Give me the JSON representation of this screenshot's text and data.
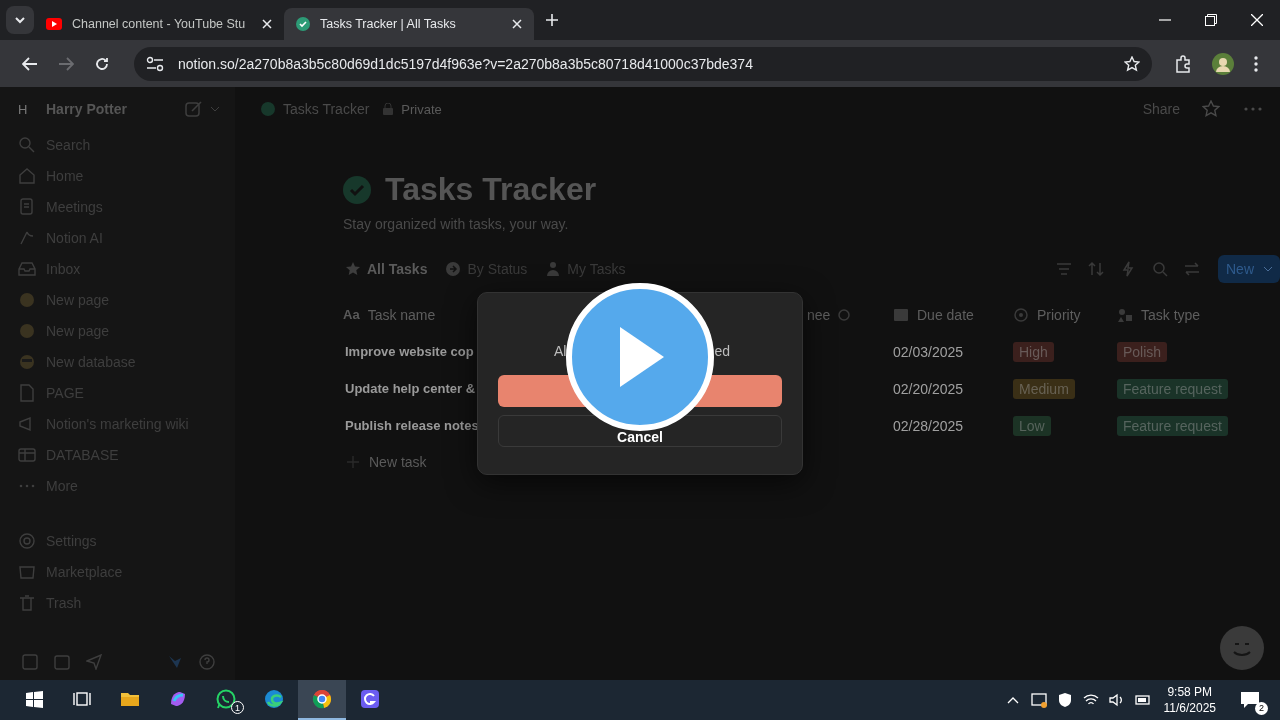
{
  "browser": {
    "tabs": [
      {
        "title": "Channel content - YouTube Stu",
        "selected": false
      },
      {
        "title": "Tasks Tracker | All Tasks",
        "selected": true
      }
    ],
    "address": "notion.so/2a270b8a3b5c80d69d1dc5197d4f963e?v=2a270b8a3b5c80718d41000c37bde374"
  },
  "sidebar": {
    "workspace_initial": "H",
    "workspace": "Harry Potter",
    "items": [
      {
        "label": "Search"
      },
      {
        "label": "Home"
      },
      {
        "label": "Meetings"
      },
      {
        "label": "Notion AI"
      },
      {
        "label": "Inbox"
      },
      {
        "label": "New page"
      },
      {
        "label": "New page"
      },
      {
        "label": "New database"
      },
      {
        "label": "PAGE"
      },
      {
        "label": "Notion's marketing wiki"
      },
      {
        "label": "DATABASE"
      },
      {
        "label": "More"
      }
    ],
    "footer_items": [
      {
        "label": "Settings"
      },
      {
        "label": "Marketplace"
      },
      {
        "label": "Trash"
      }
    ]
  },
  "topbar": {
    "breadcrumb": "Tasks Tracker",
    "privacy": "Private",
    "share": "Share"
  },
  "page": {
    "title": "Tasks Tracker",
    "subtitle": "Stay organized with tasks, your way.",
    "views": [
      {
        "label": "All Tasks",
        "selected": true
      },
      {
        "label": "By Status",
        "selected": false
      },
      {
        "label": "My Tasks",
        "selected": false
      }
    ],
    "new_button": "New",
    "table": {
      "name_column_icon": "Aa",
      "columns": [
        "Task name",
        "nee",
        "Due date",
        "Priority",
        "Task type"
      ],
      "rows": [
        {
          "task": "Improve website cop",
          "due": "02/03/2025",
          "priority": {
            "text": "High",
            "color": "#3b201d"
          },
          "type": {
            "text": "Polish",
            "color": "#3b201d"
          }
        },
        {
          "task": "Update help center &",
          "due": "02/20/2025",
          "priority": {
            "text": "Medium",
            "color": "#3a2f16"
          },
          "type": {
            "text": "Feature request",
            "color": "#1a3328"
          }
        },
        {
          "task": "Publish release notes",
          "due": "02/28/2025",
          "priority": {
            "text": "Low",
            "color": "#1c3325"
          },
          "type": {
            "text": "Feature request",
            "color": "#1a3328"
          }
        }
      ],
      "new_row": "New task"
    }
  },
  "dialog": {
    "message_start": "Al",
    "message_end": "ed",
    "cancel": "Cancel"
  },
  "taskbar": {
    "apps": [
      {
        "selected": false
      },
      {
        "selected": false
      },
      {
        "selected": false
      },
      {
        "selected": false
      },
      {
        "selected": false,
        "badge": "1"
      },
      {
        "selected": false
      },
      {
        "selected": true
      },
      {
        "selected": false
      }
    ],
    "time": "9:58 PM",
    "date": "11/6/2025",
    "notifications": "2"
  }
}
